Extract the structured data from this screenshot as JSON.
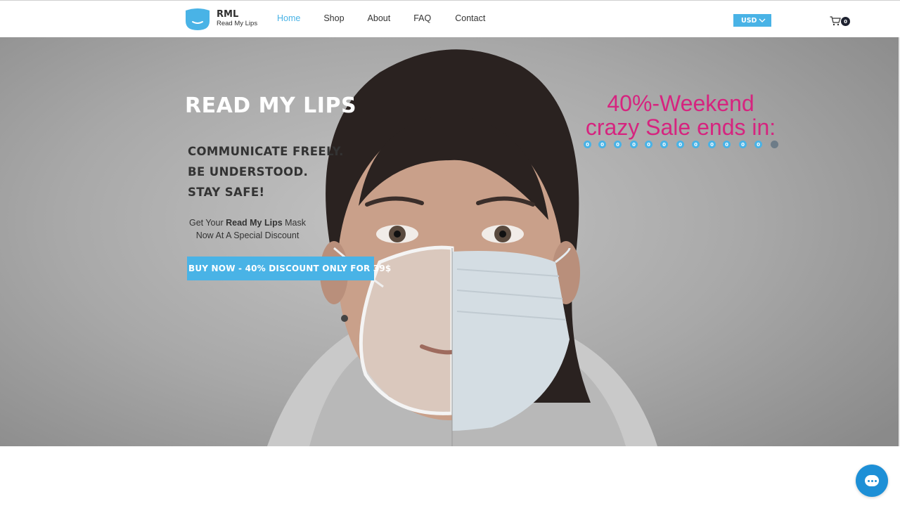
{
  "brand": {
    "abbr": "RML",
    "name": "Read My Lips",
    "logo_icon": "mask-shield-icon",
    "accent_color": "#49b3e6"
  },
  "nav": {
    "items": [
      {
        "label": "Home",
        "active": true
      },
      {
        "label": "Shop",
        "active": false
      },
      {
        "label": "About",
        "active": false
      },
      {
        "label": "FAQ",
        "active": false
      },
      {
        "label": "Contact",
        "active": false
      }
    ]
  },
  "currency": {
    "selected": "USD",
    "icon": "chevron-down-icon"
  },
  "cart": {
    "count": "0",
    "icon": "cart-icon"
  },
  "hero": {
    "title": "READ MY LIPS",
    "slogans": [
      "COMMUNICATE FREELY.",
      "BE UNDERSTOOD.",
      "STAY SAFE!"
    ],
    "offer": {
      "prefix": "Get Your ",
      "product": "Read My Lips",
      "suffix": " Mask",
      "line2": "Now At A Special Discount"
    },
    "buy_button": "BUY NOW - 40% DISCOUNT ONLY FOR 39$",
    "sale_line1": "40%-Weekend",
    "sale_line2": "crazy Sale ends in:",
    "sale_color": "#d6247f",
    "countdown": [
      "0",
      "0",
      "0",
      "0",
      "0",
      "0",
      "0",
      "0",
      "0",
      "0",
      "0",
      "0"
    ]
  },
  "chat": {
    "icon": "chat-bubble-icon",
    "color": "#1d8fd6"
  }
}
